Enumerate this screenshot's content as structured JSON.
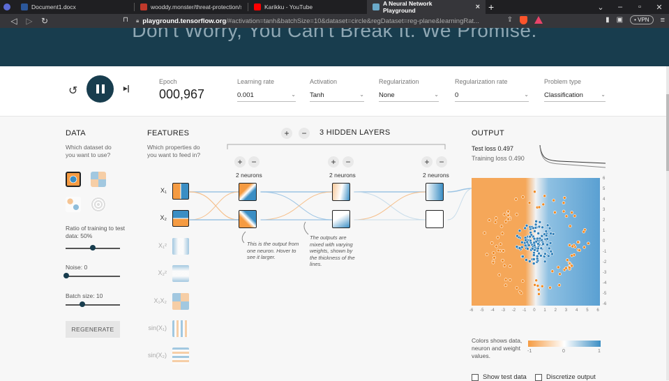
{
  "browser": {
    "tabs": [
      {
        "label": "Document1.docx",
        "color": "#2b579a"
      },
      {
        "label": "wooddy.monster/threat-protection/se",
        "color": "#c0392b"
      },
      {
        "label": "Karikku - YouTube",
        "color": "#ff0000"
      },
      {
        "label": "A Neural Network Playground",
        "color": "#6aa9c9"
      }
    ],
    "url_host": "playground.tensorflow.org",
    "url_rest": "/#activation=tanh&batchSize=10&dataset=circle&regDataset=reg-plane&learningRat...",
    "vpn_label": "• VPN"
  },
  "hero": {
    "tagline": "Don't Worry, You Can't Break It. We Promise."
  },
  "controls": {
    "epoch_label": "Epoch",
    "epoch_value": "000,967",
    "learning_rate_label": "Learning rate",
    "learning_rate_value": "0.001",
    "activation_label": "Activation",
    "activation_value": "Tanh",
    "regularization_label": "Regularization",
    "regularization_value": "None",
    "reg_rate_label": "Regularization rate",
    "reg_rate_value": "0",
    "problem_label": "Problem type",
    "problem_value": "Classification"
  },
  "data_panel": {
    "title": "DATA",
    "question": "Which dataset do you want to use?",
    "ratio_label": "Ratio of training to test data:  50%",
    "ratio_value": 0.5,
    "noise_label": "Noise:  0",
    "noise_value": 0,
    "batch_label": "Batch size:  10",
    "batch_value": 0.3,
    "regenerate": "REGENERATE"
  },
  "features_panel": {
    "title": "FEATURES",
    "question": "Which properties do you want to feed in?",
    "features": [
      {
        "label": "X₁",
        "on": true
      },
      {
        "label": "X₂",
        "on": true
      },
      {
        "label": "X₁²",
        "on": false
      },
      {
        "label": "X₂²",
        "on": false
      },
      {
        "label": "X₁X₂",
        "on": false
      },
      {
        "label": "sin(X₁)",
        "on": false
      },
      {
        "label": "sin(X₂)",
        "on": false
      }
    ]
  },
  "network": {
    "hidden_layers_label": "3  HIDDEN LAYERS",
    "layers": [
      {
        "neurons_label": "2 neurons"
      },
      {
        "neurons_label": "2 neurons"
      },
      {
        "neurons_label": "2 neurons"
      }
    ],
    "note1": "This is the output from one neuron. Hover to see it larger.",
    "note2": "The outputs are mixed with varying weights, shown by the thickness of the lines."
  },
  "output_panel": {
    "title": "OUTPUT",
    "test_loss": "Test loss 0.497",
    "training_loss": "Training loss 0.490",
    "x_ticks": [
      "-6",
      "-5",
      "-4",
      "-3",
      "-2",
      "-1",
      "0",
      "1",
      "2",
      "3",
      "4",
      "5",
      "6"
    ],
    "y_ticks": [
      "6",
      "5",
      "4",
      "3",
      "2",
      "1",
      "0",
      "-1",
      "-2",
      "-3",
      "-4",
      "-5",
      "-6"
    ],
    "legend_text": "Colors shows data, neuron and weight values.",
    "legend_min": "-1",
    "legend_mid": "0",
    "legend_max": "1",
    "show_test_data": "Show test data",
    "discretize_output": "Discretize output"
  },
  "colors": {
    "orange": "#f59b42",
    "blue": "#3b8ec4",
    "dark": "#183d4e"
  }
}
